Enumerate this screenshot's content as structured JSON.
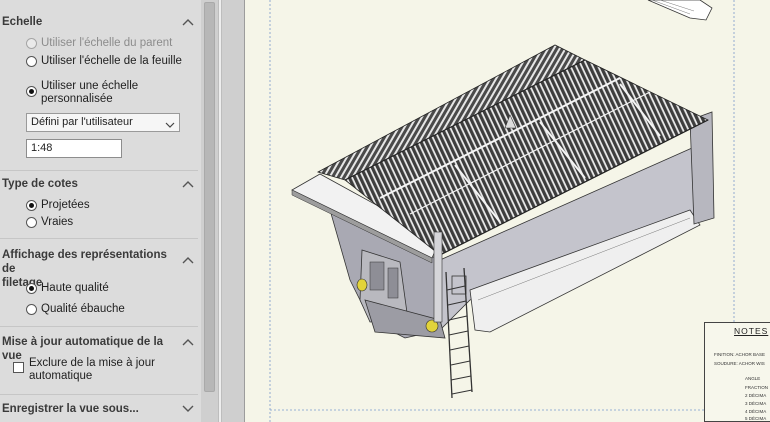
{
  "panel": {
    "scale": {
      "title": "Echelle",
      "options": [
        {
          "label": "Utiliser l'échelle du parent",
          "checked": false,
          "disabled": true
        },
        {
          "label": "Utiliser l'échelle de la feuille",
          "checked": false,
          "disabled": false
        },
        {
          "label_line1": "Utiliser une échelle",
          "label_line2": "personnalisée",
          "checked": true,
          "disabled": false
        }
      ],
      "dropdown_value": "Défini par l'utilisateur",
      "scale_value": "1:48"
    },
    "dimension_type": {
      "title": "Type de cotes",
      "options": [
        {
          "label": "Projetées",
          "checked": true
        },
        {
          "label": "Vraies",
          "checked": false
        }
      ]
    },
    "thread_display": {
      "title_line1": "Affichage des représentations de",
      "title_line2": "filetage",
      "options": [
        {
          "label": "Haute qualité",
          "checked": true
        },
        {
          "label": "Qualité ébauche",
          "checked": false
        }
      ]
    },
    "auto_update": {
      "title": "Mise à jour automatique de la vue",
      "checkbox_line1": "Exclure de la mise à jour",
      "checkbox_line2": "automatique",
      "checked": false
    },
    "save_view": {
      "title": "Enregistrer la vue sous..."
    }
  },
  "drawing": {
    "notes_title": "NOTES",
    "notes_lines": [
      "FINITION: ACHOR BASE",
      "SOUDURE: ACHOR WIS",
      "ANGLE",
      "FRACTION",
      "2 DÉCIMA",
      "3 DÉCIMA",
      "4 DÉCIMA",
      "5 DÉCIMA"
    ]
  },
  "colors": {
    "panel_bg": "#dcdcdc",
    "sheet_bg": "#f5f5e8",
    "grid_dark": "#3a3a3a",
    "steel": "#c9c9cc"
  }
}
